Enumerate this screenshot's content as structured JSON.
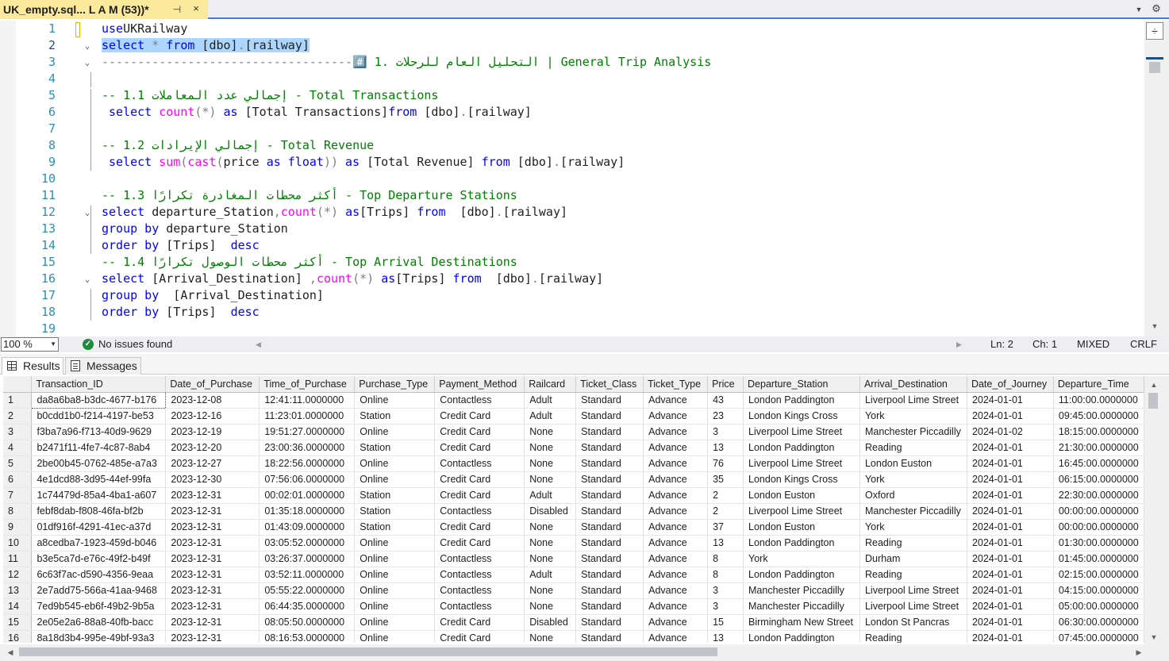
{
  "tab": {
    "title": "UK_empty.sql... L A M (53))*",
    "pin_glyph": "⊣",
    "close_glyph": "×"
  },
  "editor": {
    "lines": [
      {
        "n": "1",
        "fold": "",
        "indent": false,
        "parts": [
          [
            "kw",
            "use"
          ],
          [
            "",
            "UKRailway"
          ]
        ]
      },
      {
        "n": "2",
        "fold": "⌄",
        "indent": false,
        "sel": true,
        "parts": [
          [
            "kw",
            "select"
          ],
          [
            "",
            " "
          ],
          [
            "gr",
            "*"
          ],
          [
            "",
            " "
          ],
          [
            "kw",
            "from"
          ],
          [
            "",
            " [dbo]"
          ],
          [
            "gr",
            "."
          ],
          [
            "",
            "[railway]"
          ]
        ]
      },
      {
        "n": "3",
        "fold": "⌄",
        "indent": false,
        "parts": [
          [
            "gr",
            "-----------------------------------"
          ],
          [
            "cm",
            "#️⃣ 1. التحليل العام للرحلات | General Trip Analysis"
          ]
        ]
      },
      {
        "n": "4",
        "fold": "",
        "indent": false,
        "parts": []
      },
      {
        "n": "5",
        "fold": "",
        "indent": false,
        "parts": [
          [
            "cm",
            "-- 1.1 إجمالي عدد المعاملات - Total Transactions"
          ]
        ]
      },
      {
        "n": "6",
        "fold": "",
        "indent": true,
        "parts": [
          [
            "kw",
            "select"
          ],
          [
            "",
            " "
          ],
          [
            "fn",
            "count"
          ],
          [
            "gr",
            "(*)"
          ],
          [
            "",
            " "
          ],
          [
            "kw",
            "as"
          ],
          [
            "",
            " [Total Transactions]"
          ],
          [
            "kw",
            "from"
          ],
          [
            "",
            " [dbo]"
          ],
          [
            "gr",
            "."
          ],
          [
            "",
            "[railway]"
          ]
        ]
      },
      {
        "n": "7",
        "fold": "",
        "indent": false,
        "parts": []
      },
      {
        "n": "8",
        "fold": "",
        "indent": false,
        "parts": [
          [
            "cm",
            "-- 1.2 إجمالي الإيرادات - Total Revenue"
          ]
        ]
      },
      {
        "n": "9",
        "fold": "",
        "indent": true,
        "parts": [
          [
            "kw",
            "select"
          ],
          [
            "",
            " "
          ],
          [
            "fn",
            "sum"
          ],
          [
            "gr",
            "("
          ],
          [
            "fn",
            "cast"
          ],
          [
            "gr",
            "("
          ],
          [
            "",
            "price "
          ],
          [
            "kw",
            "as"
          ],
          [
            "",
            " "
          ],
          [
            "kw",
            "float"
          ],
          [
            "gr",
            "))"
          ],
          [
            "",
            " "
          ],
          [
            "kw",
            "as"
          ],
          [
            "",
            " [Total Revenue] "
          ],
          [
            "kw",
            "from"
          ],
          [
            "",
            " [dbo]"
          ],
          [
            "gr",
            "."
          ],
          [
            "",
            "[railway]"
          ]
        ]
      },
      {
        "n": "10",
        "fold": "",
        "indent": false,
        "parts": []
      },
      {
        "n": "11",
        "fold": "",
        "indent": false,
        "parts": [
          [
            "cm",
            "-- 1.3 أكثر محطات المغادرة تكرارًا - Top Departure Stations"
          ]
        ]
      },
      {
        "n": "12",
        "fold": "⌄",
        "indent": false,
        "parts": [
          [
            "kw",
            "select"
          ],
          [
            "",
            " departure_Station"
          ],
          [
            "gr",
            ","
          ],
          [
            "fn",
            "count"
          ],
          [
            "gr",
            "(*)"
          ],
          [
            "",
            " "
          ],
          [
            "kw",
            "as"
          ],
          [
            "",
            "[Trips] "
          ],
          [
            "kw",
            "from"
          ],
          [
            "",
            "  [dbo]"
          ],
          [
            "gr",
            "."
          ],
          [
            "",
            "[railway]"
          ]
        ]
      },
      {
        "n": "13",
        "fold": "",
        "indent": false,
        "parts": [
          [
            "kw",
            "group by"
          ],
          [
            "",
            " departure_Station"
          ]
        ]
      },
      {
        "n": "14",
        "fold": "",
        "indent": false,
        "parts": [
          [
            "kw",
            "order by"
          ],
          [
            "",
            " [Trips]  "
          ],
          [
            "kw",
            "desc"
          ]
        ]
      },
      {
        "n": "15",
        "fold": "",
        "indent": false,
        "parts": [
          [
            "cm",
            "-- 1.4 أكثر محطات الوصول تكرارًا - Top Arrival Destinations"
          ]
        ]
      },
      {
        "n": "16",
        "fold": "⌄",
        "indent": false,
        "parts": [
          [
            "kw",
            "select"
          ],
          [
            "",
            " [Arrival_Destination] "
          ],
          [
            "gr",
            ","
          ],
          [
            "fn",
            "count"
          ],
          [
            "gr",
            "(*)"
          ],
          [
            "",
            " "
          ],
          [
            "kw",
            "as"
          ],
          [
            "",
            "[Trips] "
          ],
          [
            "kw",
            "from"
          ],
          [
            "",
            "  [dbo]"
          ],
          [
            "gr",
            "."
          ],
          [
            "",
            "[railway]"
          ]
        ]
      },
      {
        "n": "17",
        "fold": "",
        "indent": false,
        "parts": [
          [
            "kw",
            "group by"
          ],
          [
            "",
            "  [Arrival_Destination]"
          ]
        ]
      },
      {
        "n": "18",
        "fold": "",
        "indent": false,
        "parts": [
          [
            "kw",
            "order by"
          ],
          [
            "",
            " [Trips]  "
          ],
          [
            "kw",
            "desc"
          ]
        ]
      },
      {
        "n": "19",
        "fold": "",
        "indent": false,
        "parts": []
      }
    ]
  },
  "status": {
    "zoom": "100 %",
    "issues": "No issues found",
    "ln": "Ln: 2",
    "col": "Ch: 1",
    "mode": "MIXED",
    "eol": "CRLF"
  },
  "results_tabs": {
    "results": "Results",
    "messages": "Messages"
  },
  "grid": {
    "columns": [
      "Transaction_ID",
      "Date_of_Purchase",
      "Time_of_Purchase",
      "Purchase_Type",
      "Payment_Method",
      "Railcard",
      "Ticket_Class",
      "Ticket_Type",
      "Price",
      "Departure_Station",
      "Arrival_Destination",
      "Date_of_Journey",
      "Departure_Time"
    ],
    "rows": [
      [
        "1",
        "da8a6ba8-b3dc-4677-b176",
        "2023-12-08",
        "12:41:11.0000000",
        "Online",
        "Contactless",
        "Adult",
        "Standard",
        "Advance",
        "43",
        "London Paddington",
        "Liverpool Lime Street",
        "2024-01-01",
        "11:00:00.0000000"
      ],
      [
        "2",
        "b0cdd1b0-f214-4197-be53",
        "2023-12-16",
        "11:23:01.0000000",
        "Station",
        "Credit Card",
        "Adult",
        "Standard",
        "Advance",
        "23",
        "London Kings Cross",
        "York",
        "2024-01-01",
        "09:45:00.0000000"
      ],
      [
        "3",
        "f3ba7a96-f713-40d9-9629",
        "2023-12-19",
        "19:51:27.0000000",
        "Online",
        "Credit Card",
        "None",
        "Standard",
        "Advance",
        "3",
        "Liverpool Lime Street",
        "Manchester Piccadilly",
        "2024-01-02",
        "18:15:00.0000000"
      ],
      [
        "4",
        "b2471f11-4fe7-4c87-8ab4",
        "2023-12-20",
        "23:00:36.0000000",
        "Station",
        "Credit Card",
        "None",
        "Standard",
        "Advance",
        "13",
        "London Paddington",
        "Reading",
        "2024-01-01",
        "21:30:00.0000000"
      ],
      [
        "5",
        "2be00b45-0762-485e-a7a3",
        "2023-12-27",
        "18:22:56.0000000",
        "Online",
        "Contactless",
        "None",
        "Standard",
        "Advance",
        "76",
        "Liverpool Lime Street",
        "London Euston",
        "2024-01-01",
        "16:45:00.0000000"
      ],
      [
        "6",
        "4e1dcd88-3d95-44ef-99fa",
        "2023-12-30",
        "07:56:06.0000000",
        "Online",
        "Credit Card",
        "None",
        "Standard",
        "Advance",
        "35",
        "London Kings Cross",
        "York",
        "2024-01-01",
        "06:15:00.0000000"
      ],
      [
        "7",
        "1c74479d-85a4-4ba1-a607",
        "2023-12-31",
        "00:02:01.0000000",
        "Station",
        "Credit Card",
        "Adult",
        "Standard",
        "Advance",
        "2",
        "London Euston",
        "Oxford",
        "2024-01-01",
        "22:30:00.0000000"
      ],
      [
        "8",
        "febf8dab-f808-46fa-bf2b",
        "2023-12-31",
        "01:35:18.0000000",
        "Station",
        "Contactless",
        "Disabled",
        "Standard",
        "Advance",
        "2",
        "Liverpool Lime Street",
        "Manchester Piccadilly",
        "2024-01-01",
        "00:00:00.0000000"
      ],
      [
        "9",
        "01df916f-4291-41ec-a37d",
        "2023-12-31",
        "01:43:09.0000000",
        "Station",
        "Credit Card",
        "None",
        "Standard",
        "Advance",
        "37",
        "London Euston",
        "York",
        "2024-01-01",
        "00:00:00.0000000"
      ],
      [
        "10",
        "a8cedba7-1923-459d-b046",
        "2023-12-31",
        "03:05:52.0000000",
        "Online",
        "Credit Card",
        "None",
        "Standard",
        "Advance",
        "13",
        "London Paddington",
        "Reading",
        "2024-01-01",
        "01:30:00.0000000"
      ],
      [
        "11",
        "b3e5ca7d-e76c-49f2-b49f",
        "2023-12-31",
        "03:26:37.0000000",
        "Online",
        "Contactless",
        "None",
        "Standard",
        "Advance",
        "8",
        "York",
        "Durham",
        "2024-01-01",
        "01:45:00.0000000"
      ],
      [
        "12",
        "6c63f7ac-d590-4356-9eaa",
        "2023-12-31",
        "03:52:11.0000000",
        "Online",
        "Contactless",
        "Adult",
        "Standard",
        "Advance",
        "8",
        "London Paddington",
        "Reading",
        "2024-01-01",
        "02:15:00.0000000"
      ],
      [
        "13",
        "2e7add75-566a-41aa-9468",
        "2023-12-31",
        "05:55:22.0000000",
        "Online",
        "Contactless",
        "None",
        "Standard",
        "Advance",
        "3",
        "Manchester Piccadilly",
        "Liverpool Lime Street",
        "2024-01-01",
        "04:15:00.0000000"
      ],
      [
        "14",
        "7ed9b545-eb6f-49b2-9b5a",
        "2023-12-31",
        "06:44:35.0000000",
        "Online",
        "Contactless",
        "None",
        "Standard",
        "Advance",
        "3",
        "Manchester Piccadilly",
        "Liverpool Lime Street",
        "2024-01-01",
        "05:00:00.0000000"
      ],
      [
        "15",
        "2e05e2a6-88a8-40fb-bacc",
        "2023-12-31",
        "08:05:50.0000000",
        "Online",
        "Credit Card",
        "Disabled",
        "Standard",
        "Advance",
        "15",
        "Birmingham New Street",
        "London St Pancras",
        "2024-01-01",
        "06:30:00.0000000"
      ],
      [
        "16",
        "8a18d3b4-995e-49bf-93a3",
        "2023-12-31",
        "08:16:53.0000000",
        "Online",
        "Credit Card",
        "None",
        "Standard",
        "Advance",
        "13",
        "London Paddington",
        "Reading",
        "2024-01-01",
        "07:45:00.0000000"
      ]
    ]
  },
  "colors": {
    "keyword": "#0000ff",
    "function": "#ff00ff",
    "comment": "#008000",
    "line_number": "#2b91af",
    "tab_active": "#fbe99c",
    "selection": "#add6ff"
  }
}
